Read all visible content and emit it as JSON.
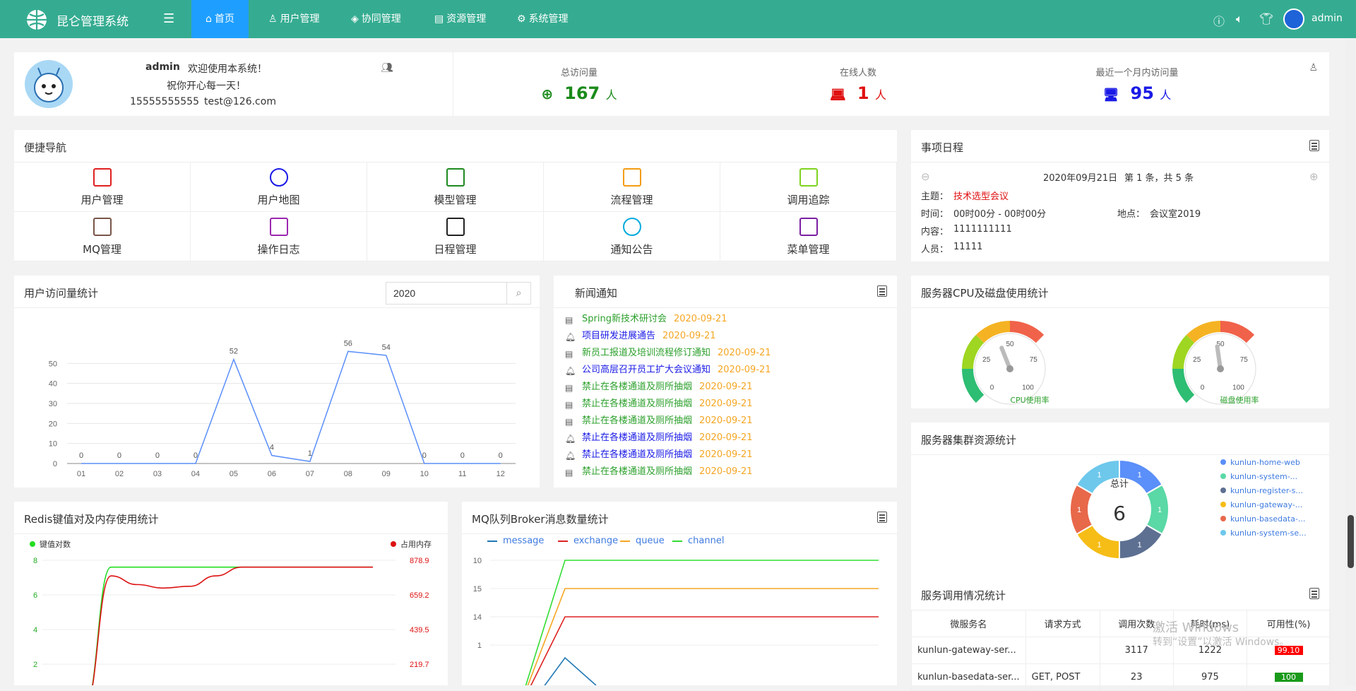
{
  "app": {
    "title": "昆仑管理系统",
    "user": "admin"
  },
  "nav": [
    {
      "label": "首页",
      "icon": "home-icon",
      "active": true
    },
    {
      "label": "用户管理",
      "icon": "user-icon"
    },
    {
      "label": "协同管理",
      "icon": "cube-icon"
    },
    {
      "label": "资源管理",
      "icon": "file-icon"
    },
    {
      "label": "系统管理",
      "icon": "gear-icon"
    }
  ],
  "profile": {
    "name": "admin",
    "welcome": "欢迎使用本系统！",
    "wish": "祝你开心每一天！",
    "phone": "15555555555",
    "email": "test@126.com"
  },
  "stats": {
    "total_label": "总访问量",
    "total_value": "167",
    "total_unit": "人",
    "online_label": "在线人数",
    "online_value": "1",
    "online_unit": "人",
    "month_label": "最近一个月内访问量",
    "month_value": "95",
    "month_unit": "人"
  },
  "quicknav": {
    "title": "便捷导航",
    "items": [
      {
        "label": "用户管理",
        "icon": "user-card-icon",
        "color": "#e02020"
      },
      {
        "label": "用户地图",
        "icon": "map-pin-icon",
        "color": "#1a1ae6"
      },
      {
        "label": "模型管理",
        "icon": "model-icon",
        "color": "#1f8a1f"
      },
      {
        "label": "流程管理",
        "icon": "sliders-icon",
        "color": "#f39c12"
      },
      {
        "label": "调用追踪",
        "icon": "search-doc-icon",
        "color": "#7ed321"
      },
      {
        "label": "MQ管理",
        "icon": "mq-icon",
        "color": "#795548"
      },
      {
        "label": "操作日志",
        "icon": "log-icon",
        "color": "#9c27b0"
      },
      {
        "label": "日程管理",
        "icon": "schedule-icon",
        "color": "#222222"
      },
      {
        "label": "通知公告",
        "icon": "chat-icon",
        "color": "#00aadd"
      },
      {
        "label": "菜单管理",
        "icon": "menu-grid-icon",
        "color": "#7b1fa2"
      }
    ]
  },
  "schedule": {
    "title": "事项日程",
    "date": "2020年09月21日",
    "paging": "第 1 条，共 5 条",
    "subject_label": "主题：",
    "subject": "技术选型会议",
    "time_label": "时间：",
    "time": "00时00分 - 00时00分",
    "place_label": "地点：",
    "place": "会议室2019",
    "content_label": "内容：",
    "content": "1111111111",
    "people_label": "人员：",
    "people": "11111"
  },
  "visits": {
    "title": "用户访问量统计",
    "year": "2020"
  },
  "news": {
    "title": "新闻通知",
    "items": [
      {
        "text": "Spring新技术研讨会",
        "date": "2020-09-21",
        "kind": "news",
        "color": "#2ca02c"
      },
      {
        "text": "项目研发进展通告",
        "date": "2020-09-21",
        "kind": "notice",
        "color": "#1a1ae6"
      },
      {
        "text": "新员工报道及培训流程修订通知",
        "date": "2020-09-21",
        "kind": "news",
        "color": "#2ca02c"
      },
      {
        "text": "公司高层召开员工扩大会议通知",
        "date": "2020-09-21",
        "kind": "notice",
        "color": "#1a1ae6"
      },
      {
        "text": "禁止在各楼通道及厕所抽烟",
        "date": "2020-09-21",
        "kind": "news",
        "color": "#2ca02c"
      },
      {
        "text": "禁止在各楼通道及厕所抽烟",
        "date": "2020-09-21",
        "kind": "news",
        "color": "#2ca02c"
      },
      {
        "text": "禁止在各楼通道及厕所抽烟",
        "date": "2020-09-21",
        "kind": "news",
        "color": "#2ca02c"
      },
      {
        "text": "禁止在各楼通道及厕所抽烟",
        "date": "2020-09-21",
        "kind": "notice",
        "color": "#1a1ae6"
      },
      {
        "text": "禁止在各楼通道及厕所抽烟",
        "date": "2020-09-21",
        "kind": "notice",
        "color": "#1a1ae6"
      },
      {
        "text": "禁止在各楼通道及厕所抽烟",
        "date": "2020-09-21",
        "kind": "news",
        "color": "#2ca02c"
      }
    ]
  },
  "cpu": {
    "title": "服务器CPU及磁盘使用统计",
    "cpu_label": "CPU使用率",
    "disk_label": "磁盘使用率"
  },
  "cluster": {
    "title": "服务器集群资源统计",
    "center_label": "总计",
    "center_value": "6"
  },
  "redis": {
    "title": "Redis键值对及内存使用统计",
    "legend_keys": "键值对数",
    "legend_mem": "占用内存"
  },
  "mq": {
    "title": "MQ队列Broker消息数量统计"
  },
  "services": {
    "title": "服务调用情况统计",
    "headers": [
      "微服务名",
      "请求方式",
      "调用次数",
      "耗时(ms)",
      "可用性(%)"
    ],
    "rows": [
      {
        "name": "kunlun-gateway-ser...",
        "method": "",
        "count": "3117",
        "time": "1222",
        "avail": "99.10",
        "avail_color": "#ff0000"
      },
      {
        "name": "kunlun-basedata-ser...",
        "method": "GET, POST",
        "count": "23",
        "time": "975",
        "avail": "100",
        "avail_color": "#1a9a1a"
      }
    ]
  },
  "watermark": {
    "line1": "激活 Windows",
    "line2": "转到“设置”以激活 Windows。"
  },
  "chart_data": [
    {
      "type": "line",
      "title": "用户访问量统计",
      "categories": [
        "01",
        "02",
        "03",
        "04",
        "05",
        "06",
        "07",
        "08",
        "09",
        "10",
        "11",
        "12"
      ],
      "series": [
        {
          "values": [
            0,
            0,
            0,
            0,
            52,
            4,
            1,
            56,
            54,
            0,
            0,
            0
          ]
        }
      ],
      "ylim": [
        0,
        60
      ],
      "yticks": [
        0,
        10,
        20,
        30,
        40,
        50
      ],
      "grid": true
    },
    {
      "type": "gauge",
      "title": "服务器CPU及磁盘使用统计",
      "series": [
        {
          "name": "CPU使用率",
          "values": [
            42
          ]
        },
        {
          "name": "磁盘使用率",
          "values": [
            47
          ]
        }
      ],
      "ticks": [
        "0",
        "25",
        "50",
        "75",
        "100"
      ]
    },
    {
      "type": "pie",
      "title": "服务器集群资源统计",
      "categories": [
        "kunlun-home-web",
        "kunlun-system-...",
        "kunlun-register-s...",
        "kunlun-gateway-...",
        "kunlun-basedata-...",
        "kunlun-system-se..."
      ],
      "values": [
        1,
        1,
        1,
        1,
        1,
        1
      ],
      "colors": [
        "#5b8ff9",
        "#5ad8a6",
        "#5d7092",
        "#f6bd16",
        "#e8684a",
        "#6dc8ec"
      ],
      "total": 6,
      "legend": "right"
    },
    {
      "type": "line",
      "title": "Redis键值对及内存使用统计",
      "series": [
        {
          "name": "键值对数",
          "color": "#22dd22",
          "values": [
            0,
            8,
            8,
            8,
            8,
            8,
            8,
            8,
            8,
            8,
            8,
            8
          ]
        },
        {
          "name": "占用内存",
          "color": "#dd1111",
          "values": [
            0,
            7.5,
            7.0,
            6.8,
            6.9,
            7.5,
            8,
            8,
            8,
            8,
            8,
            8
          ]
        }
      ],
      "yticks_left": [
        "2",
        "4",
        "6",
        "8"
      ],
      "yticks_right": [
        "219.7",
        "439.5",
        "659.2",
        "878.9"
      ]
    },
    {
      "type": "line",
      "title": "MQ队列Broker消息数量统计",
      "yticks": [
        "1",
        "14",
        "15",
        "10"
      ],
      "series": [
        {
          "name": "message",
          "color": "#1f77b4",
          "values": [
            0,
            1,
            0
          ]
        },
        {
          "name": "exchange",
          "color": "#dd2222",
          "values": [
            0,
            14,
            14,
            14,
            14
          ]
        },
        {
          "name": "queue",
          "color": "#f5a623",
          "values": [
            0,
            15,
            15,
            15,
            15
          ]
        },
        {
          "name": "channel",
          "color": "#33dd33",
          "values": [
            0,
            10,
            10,
            10,
            10
          ]
        }
      ],
      "legend": "top"
    }
  ]
}
